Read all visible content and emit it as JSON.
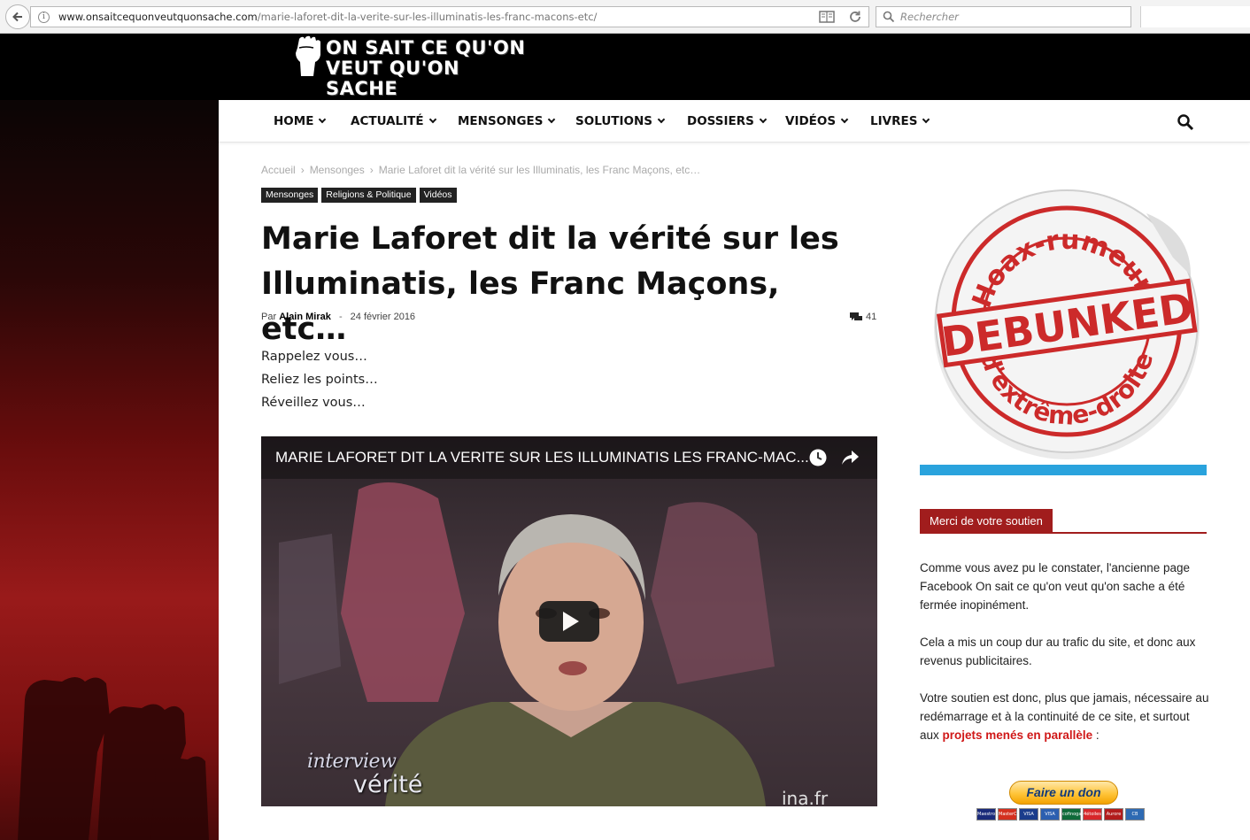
{
  "browser": {
    "url_domain": "www.onsaitcequonveutquonsache.com",
    "url_path": "/marie-laforet-dit-la-verite-sur-les-illuminatis-les-franc-macons-etc/",
    "search_placeholder": "Rechercher"
  },
  "site": {
    "logo_line1": "ON SAIT CE QU'ON",
    "logo_line2": "VEUT QU'ON SACHE"
  },
  "nav": {
    "items": [
      {
        "label": "HOME"
      },
      {
        "label": "ACTUALITÉ"
      },
      {
        "label": "MENSONGES"
      },
      {
        "label": "SOLUTIONS"
      },
      {
        "label": "DOSSIERS"
      },
      {
        "label": "VIDÉOS"
      },
      {
        "label": "LIVRES"
      }
    ]
  },
  "breadcrumb": [
    "Accueil",
    "Mensonges",
    "Marie Laforet dit la vérité sur les Illuminatis, les Franc Maçons, etc…"
  ],
  "tags": [
    "Mensonges",
    "Religions & Politique",
    "Vidéos"
  ],
  "article": {
    "title": "Marie Laforet dit la vérité sur les Illuminatis, les Franc Maçons, etc…",
    "by_label": "Par",
    "author": "Alain Mirak",
    "date": "24 février 2016",
    "comment_count": "41",
    "intro": [
      "Rappelez vous…",
      "Reliez les points…",
      "Réveillez vous…"
    ]
  },
  "video": {
    "title": "MARIE LAFORET DIT LA VERITE SUR LES ILLUMINATIS LES FRANC-MAC...",
    "watermark_interview": "interview",
    "watermark_verite": "vérité",
    "watermark_ina": "ina.fr"
  },
  "sidebar": {
    "sticker_top": "Hoax-rumeurs",
    "sticker_center": "DEBUNKED",
    "sticker_bottom": "d'extrême-droite",
    "support_title": "Merci de votre soutien",
    "para1": "Comme vous avez pu le constater, l'ancienne page Facebook On sait ce qu'on veut qu'on sache a été fermée inopinément.",
    "para2": "Cela a mis un coup dur au trafic du site, et donc aux revenus publicitaires.",
    "para3_start": "Votre soutien est donc, plus que jamais, nécessaire au redémarrage et à la continuité de ce site, et surtout aux ",
    "para3_link": "projets menés en parallèle",
    "para3_end": " :",
    "donate_label": "Faire un don",
    "cards": [
      {
        "label": "Maestro",
        "color": "#1a2a7a"
      },
      {
        "label": "MasterCard",
        "color": "#d4301f"
      },
      {
        "label": "VISA",
        "color": "#1a3c8c"
      },
      {
        "label": "VISA",
        "color": "#2b5fb0"
      },
      {
        "label": "cofinoga",
        "color": "#0f6b3a"
      },
      {
        "label": "4étoiles",
        "color": "#d7262a"
      },
      {
        "label": "Aurore",
        "color": "#b21c1c"
      },
      {
        "label": "CB",
        "color": "#2e6ab3"
      }
    ]
  }
}
